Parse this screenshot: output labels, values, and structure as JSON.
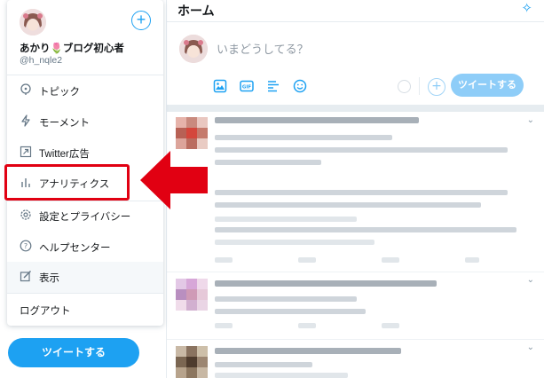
{
  "header": {
    "title": "ホーム"
  },
  "composer": {
    "placeholder": "いまどうしてる？",
    "tweet_button": "ツイートする"
  },
  "profile": {
    "display_name": "あかり🌷ブログ初心者",
    "handle": "@h_nqle2"
  },
  "menu": {
    "items": [
      {
        "label": "トピック",
        "icon": "topic-icon"
      },
      {
        "label": "モーメント",
        "icon": "lightning-icon"
      },
      {
        "label": "Twitter広告",
        "icon": "ads-icon"
      },
      {
        "label": "アナリティクス",
        "icon": "analytics-icon"
      },
      {
        "label": "設定とプライバシー",
        "icon": "gear-icon"
      },
      {
        "label": "ヘルプセンター",
        "icon": "help-icon"
      },
      {
        "label": "表示",
        "icon": "display-icon"
      },
      {
        "label": "ログアウト",
        "icon": ""
      }
    ]
  },
  "sidebar": {
    "tweet_button": "ツイートする"
  },
  "colors": {
    "accent": "#1da1f2",
    "accent_disabled": "#8ecdf8",
    "highlight": "#e10012"
  }
}
